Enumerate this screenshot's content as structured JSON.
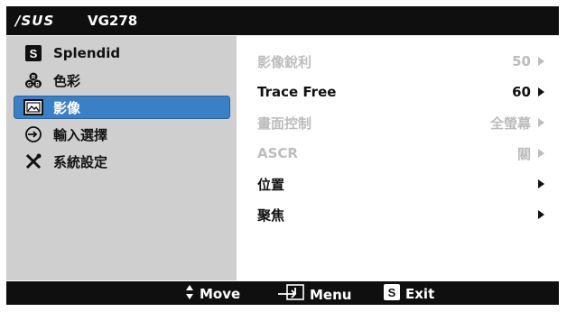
{
  "title": {
    "brand": "/SUS",
    "model": "VG278"
  },
  "sidebar": {
    "items": [
      {
        "label": "Splendid",
        "icon": "splendid-s-icon"
      },
      {
        "label": "色彩",
        "icon": "color-dots-icon"
      },
      {
        "label": "影像",
        "icon": "image-icon"
      },
      {
        "label": "輸入選擇",
        "icon": "input-select-icon"
      },
      {
        "label": "系統設定",
        "icon": "tools-icon"
      }
    ],
    "selected": "影像"
  },
  "submenu": {
    "items": [
      {
        "label": "影像銳利",
        "value": "50",
        "enabled": false
      },
      {
        "label": "Trace Free",
        "value": "60",
        "enabled": true
      },
      {
        "label": "畫面控制",
        "value": "全螢幕",
        "enabled": false
      },
      {
        "label": "ASCR",
        "value": "關",
        "enabled": false
      },
      {
        "label": "位置",
        "value": "",
        "enabled": true
      },
      {
        "label": "聚焦",
        "value": "",
        "enabled": true
      }
    ]
  },
  "footer": {
    "move_label": "Move",
    "menu_label": "Menu",
    "exit_label": "Exit",
    "exit_key": "S"
  },
  "colors": {
    "title_bg": "#0f0f0f",
    "sidebar_bg": "#cfcfcf",
    "selected_bg": "#3b7fc4",
    "disabled_text": "#bdbdbd"
  }
}
